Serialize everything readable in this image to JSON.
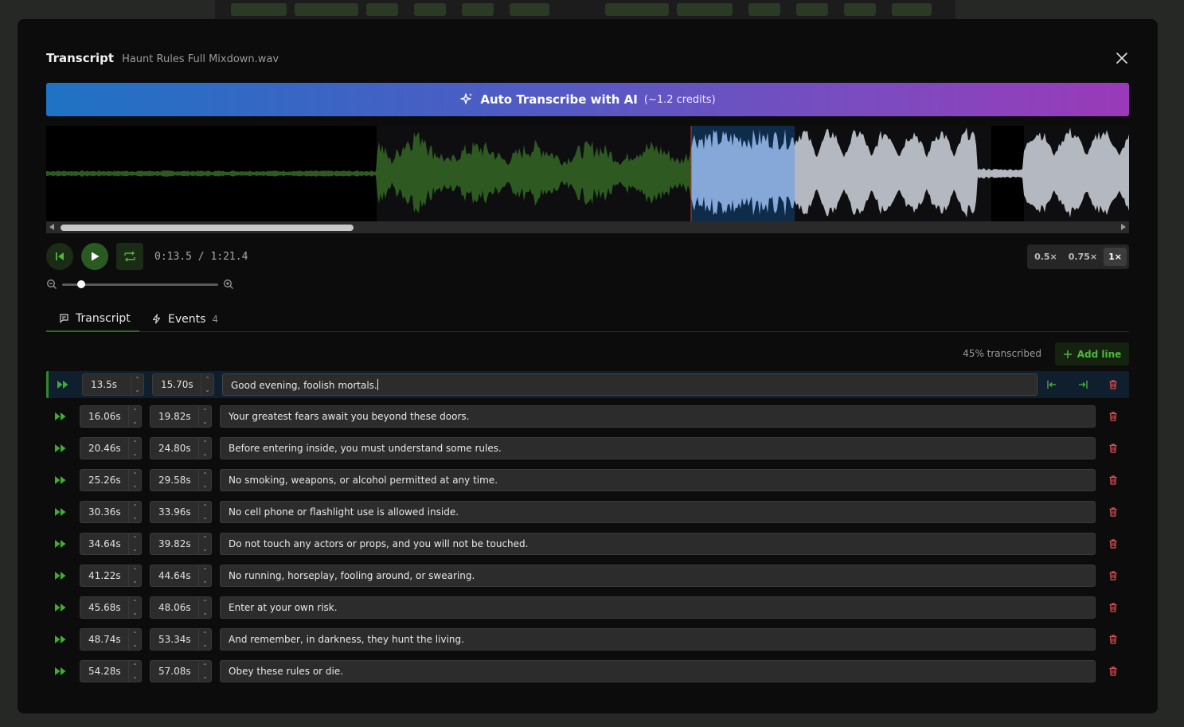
{
  "modal": {
    "title": "Transcript",
    "filename": "Haunt Rules Full Mixdown.wav"
  },
  "ai_button": {
    "label": "Auto Transcribe with AI",
    "credits": "(~1.2 credits)"
  },
  "player": {
    "time": "0:13.5 / 1:21.4",
    "speeds": [
      "0.5×",
      "0.75×",
      "1×"
    ],
    "active_speed": "1×",
    "zoom_level": 0.12
  },
  "tabs": {
    "transcript": "Transcript",
    "events": "Events",
    "events_count": "4"
  },
  "status": {
    "progress": "45% transcribed",
    "add_line": "Add line"
  },
  "colors": {
    "accent": "#4db83a",
    "selection": "#7e9ec8",
    "delete": "#e05252",
    "ai_gradient_start": "#1f73c4",
    "ai_gradient_end": "#9a3ab8"
  },
  "lines": [
    {
      "start": "13.5s",
      "end": "15.70s",
      "text": "Good evening, foolish mortals.",
      "active": true
    },
    {
      "start": "16.06s",
      "end": "19.82s",
      "text": "Your greatest fears await you beyond these doors."
    },
    {
      "start": "20.46s",
      "end": "24.80s",
      "text": "Before entering inside, you must understand some rules."
    },
    {
      "start": "25.26s",
      "end": "29.58s",
      "text": "No smoking, weapons, or alcohol permitted at any time."
    },
    {
      "start": "30.36s",
      "end": "33.96s",
      "text": "No cell phone or flashlight use is allowed inside."
    },
    {
      "start": "34.64s",
      "end": "39.82s",
      "text": "Do not touch any actors or props, and you will not be touched."
    },
    {
      "start": "41.22s",
      "end": "44.64s",
      "text": "No running, horseplay, fooling around, or swearing."
    },
    {
      "start": "45.68s",
      "end": "48.06s",
      "text": "Enter at your own risk."
    },
    {
      "start": "48.74s",
      "end": "53.34s",
      "text": "And remember, in darkness, they hunt the living."
    },
    {
      "start": "54.28s",
      "end": "57.08s",
      "text": "Obey these rules or die."
    }
  ]
}
